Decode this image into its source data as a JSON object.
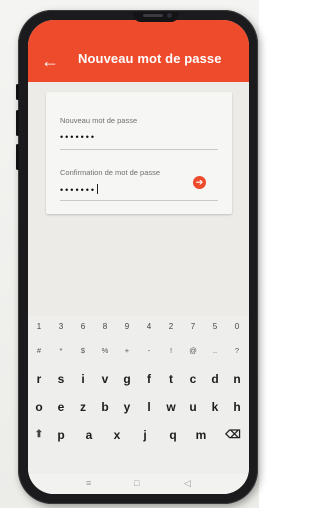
{
  "header": {
    "back_glyph": "←",
    "title": "Nouveau mot de passe"
  },
  "form": {
    "new_password": {
      "label": "Nouveau mot de passe",
      "value": "•••••••"
    },
    "confirm_password": {
      "label": "Confirmation de mot de passe",
      "value": "•••••••"
    },
    "submit_glyph": "➔"
  },
  "keyboard": {
    "number_row": [
      "1",
      "3",
      "6",
      "8",
      "9",
      "4",
      "2",
      "7",
      "5",
      "0"
    ],
    "symbol_row": [
      "#",
      "*",
      "$",
      "%",
      "+",
      "-",
      "!",
      "@",
      "..",
      "?"
    ],
    "row1": [
      "r",
      "s",
      "i",
      "v",
      "g",
      "f",
      "t",
      "c",
      "d",
      "n"
    ],
    "row2": [
      "o",
      "e",
      "z",
      "b",
      "y",
      "l",
      "w",
      "u",
      "k",
      "h"
    ],
    "row3": [
      "⬆",
      "p",
      "a",
      "x",
      "j",
      "q",
      "m",
      "⌫"
    ]
  },
  "nav": {
    "menu_glyph": "≡",
    "home_glyph": "□",
    "back_glyph": "◁"
  },
  "colors": {
    "accent": "#ee4a2c",
    "app_bar_text": "#ffffff",
    "card_bg": "#f6f6f4"
  }
}
